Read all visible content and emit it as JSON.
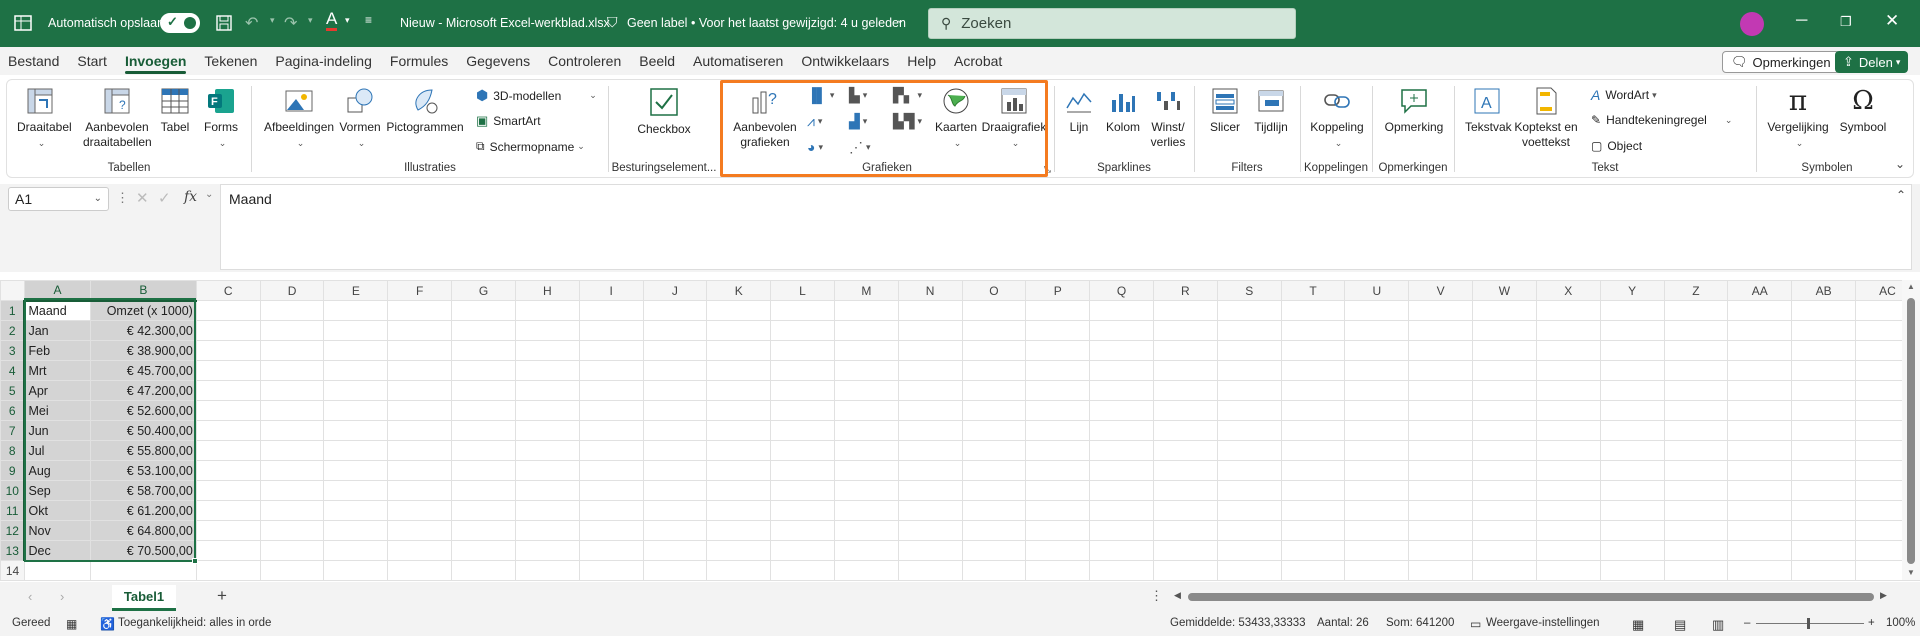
{
  "titlebar": {
    "autosave_label": "Automatisch opslaan",
    "doc_title": "Nieuw - Microsoft Excel-werkblad.xlsx",
    "label_status": "Geen label",
    "modified": "• Voor het laatst gewijzigd: 4 u geleden",
    "search_placeholder": "Zoeken",
    "accent": "#1e7145",
    "avatar_color": "#c239b3"
  },
  "menu": {
    "tabs": [
      "Bestand",
      "Start",
      "Invoegen",
      "Tekenen",
      "Pagina-indeling",
      "Formules",
      "Gegevens",
      "Controleren",
      "Beeld",
      "Automatiseren",
      "Ontwikkelaars",
      "Help",
      "Acrobat"
    ],
    "active": "Invoegen",
    "comments": "Opmerkingen",
    "share": "Delen"
  },
  "ribbon": {
    "tabellen": {
      "label": "Tabellen",
      "pivot": "Draaitabel",
      "rec_pivot": "Aanbevolen draaitabellen",
      "table": "Tabel",
      "forms": "Forms"
    },
    "illustraties": {
      "label": "Illustraties",
      "images": "Afbeeldingen",
      "shapes": "Vormen",
      "icons": "Pictogrammen",
      "models": "3D-modellen",
      "smartart": "SmartArt",
      "screenshot": "Schermopname"
    },
    "besturing": {
      "label": "Besturingselement...",
      "checkbox": "Checkbox"
    },
    "grafieken": {
      "label": "Grafieken",
      "rec_charts": "Aanbevolen grafieken",
      "maps": "Kaarten",
      "pivotchart": "Draaigrafiek"
    },
    "sparklines": {
      "label": "Sparklines",
      "line": "Lijn",
      "column": "Kolom",
      "winloss": "Winst/ verlies"
    },
    "filters": {
      "label": "Filters",
      "slicer": "Slicer",
      "timeline": "Tijdlijn"
    },
    "koppelingen": {
      "label": "Koppelingen",
      "link": "Koppeling"
    },
    "opmerkingen": {
      "label": "Opmerkingen",
      "comment": "Opmerking"
    },
    "tekst": {
      "label": "Tekst",
      "textbox": "Tekstvak",
      "headerfooter": "Koptekst en voettekst",
      "wordart": "WordArt",
      "signature": "Handtekeningregel",
      "object": "Object"
    },
    "symbolen": {
      "label": "Symbolen",
      "equation": "Vergelijking",
      "symbol": "Symbool"
    },
    "highlight_color": "#f47b20"
  },
  "formula": {
    "namebox": "A1",
    "content": "Maand"
  },
  "columns": [
    "A",
    "B",
    "C",
    "D",
    "E",
    "F",
    "G",
    "H",
    "I",
    "J",
    "K",
    "L",
    "M",
    "N",
    "O",
    "P",
    "Q",
    "R",
    "S",
    "T",
    "U",
    "V",
    "W",
    "X",
    "Y",
    "Z",
    "AA",
    "AB",
    "AC"
  ],
  "rows": [
    {
      "n": "1",
      "a": "Maand",
      "b": "Omzet (x 1000)"
    },
    {
      "n": "2",
      "a": "Jan",
      "b": "€ 42.300,00"
    },
    {
      "n": "3",
      "a": "Feb",
      "b": "€ 38.900,00"
    },
    {
      "n": "4",
      "a": "Mrt",
      "b": "€ 45.700,00"
    },
    {
      "n": "5",
      "a": "Apr",
      "b": "€ 47.200,00"
    },
    {
      "n": "6",
      "a": "Mei",
      "b": "€ 52.600,00"
    },
    {
      "n": "7",
      "a": "Jun",
      "b": "€ 50.400,00"
    },
    {
      "n": "8",
      "a": "Jul",
      "b": "€ 55.800,00"
    },
    {
      "n": "9",
      "a": "Aug",
      "b": "€ 53.100,00"
    },
    {
      "n": "10",
      "a": "Sep",
      "b": "€ 58.700,00"
    },
    {
      "n": "11",
      "a": "Okt",
      "b": "€ 61.200,00"
    },
    {
      "n": "12",
      "a": "Nov",
      "b": "€ 64.800,00"
    },
    {
      "n": "13",
      "a": "Dec",
      "b": "€ 70.500,00"
    },
    {
      "n": "14",
      "a": "",
      "b": ""
    }
  ],
  "sheet": {
    "tab": "Tabel1"
  },
  "status": {
    "ready": "Gereed",
    "accessibility": "Toegankelijkheid: alles in orde",
    "average": "Gemiddelde: 53433,33333",
    "count": "Aantal: 26",
    "sum": "Som: 641200",
    "display": "Weergave-instellingen",
    "zoom": "100%"
  }
}
